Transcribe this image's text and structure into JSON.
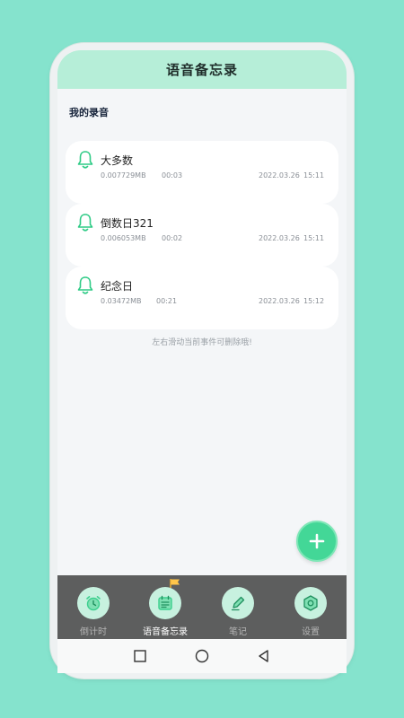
{
  "header": {
    "title": "语音备忘录"
  },
  "section_title": "我的录音",
  "recordings": [
    {
      "name": "大多数",
      "size": "0.007729MB",
      "duration": "00:03",
      "date": "2022.03.26",
      "time": "15:11"
    },
    {
      "name": "倒数日321",
      "size": "0.006053MB",
      "duration": "00:02",
      "date": "2022.03.26",
      "time": "15:11"
    },
    {
      "name": "纪念日",
      "size": "0.03472MB",
      "duration": "00:21",
      "date": "2022.03.26",
      "time": "15:12"
    }
  ],
  "hint": "左右滑动当前事件可删除哦!",
  "fab": {
    "icon": "plus-icon"
  },
  "tabs": [
    {
      "label": "倒计时",
      "icon": "alarm-clock-icon",
      "active": false
    },
    {
      "label": "语音备忘录",
      "icon": "calendar-list-icon",
      "active": true
    },
    {
      "label": "笔记",
      "icon": "pen-icon",
      "active": false
    },
    {
      "label": "设置",
      "icon": "gear-nut-icon",
      "active": false
    }
  ],
  "colors": {
    "accent": "#43d797",
    "header_bg": "#b6eed8",
    "tabbar_bg": "#5d5e5e",
    "outer_bg": "#85e3cd"
  }
}
